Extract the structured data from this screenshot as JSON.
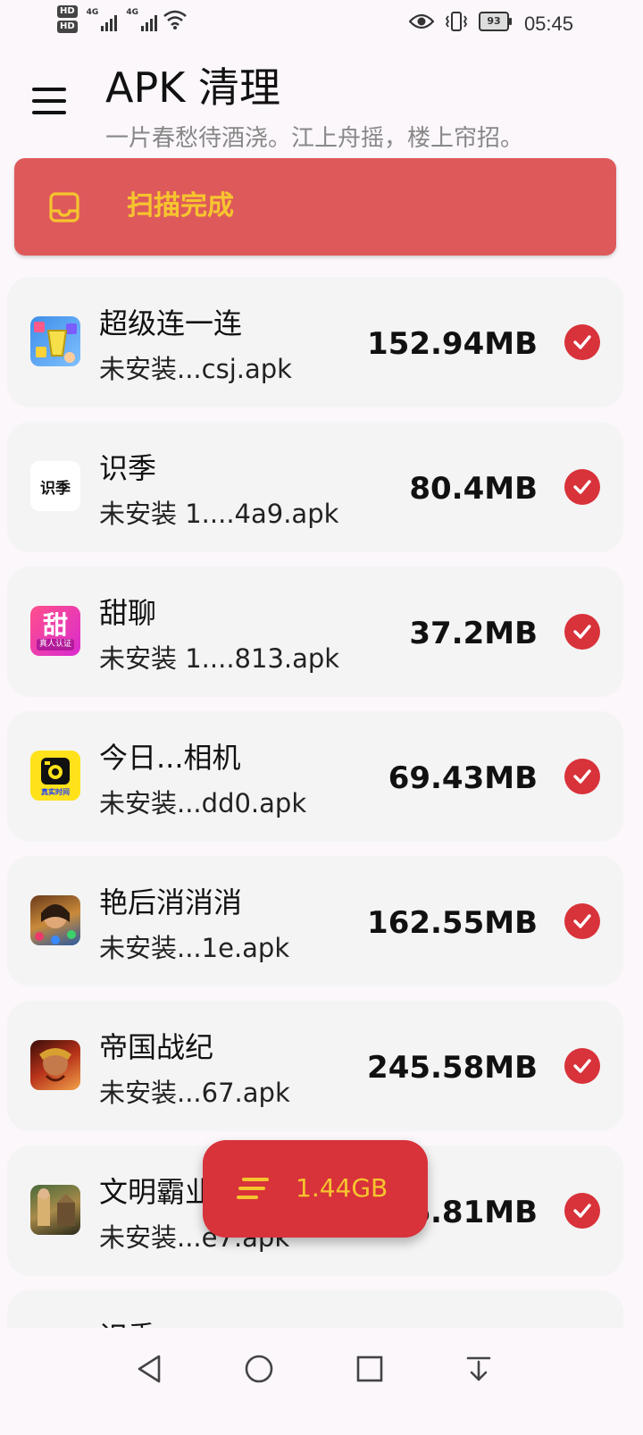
{
  "status_bar": {
    "hd1": "HD",
    "hd2": "HD",
    "net1": "4G",
    "net2": "4G",
    "battery": "93",
    "time": "05:45"
  },
  "header": {
    "title": "APK 清理",
    "subtitle": "一片春愁待酒浇。江上舟摇，楼上帘招。"
  },
  "banner": {
    "status": "扫描完成",
    "icon": "inbox-icon"
  },
  "apps": [
    {
      "name": "超级连一连",
      "file": "未安装...csj.apk",
      "size": "152.94MB"
    },
    {
      "name": "识季",
      "file": "未安装 1....4a9.apk",
      "size": "80.4MB"
    },
    {
      "name": "甜聊",
      "file": "未安装 1....813.apk",
      "size": "37.2MB"
    },
    {
      "name": "今日...相机",
      "file": "未安装...dd0.apk",
      "size": "69.43MB"
    },
    {
      "name": "艳后消消消",
      "file": "未安装...1e.apk",
      "size": "162.55MB"
    },
    {
      "name": "帝国战纪",
      "file": "未安装...67.apk",
      "size": "245.58MB"
    },
    {
      "name": "文明霸业",
      "file": "未安装...e7.apk",
      "size": "66.81MB"
    },
    {
      "name": "识季",
      "file": "",
      "size": ""
    }
  ],
  "icon_text": {
    "shiji": "识季",
    "tian": "甜",
    "tian_sub": "真人认证",
    "jinri_sub": "真实时间"
  },
  "fab": {
    "total": "1.44GB"
  },
  "colors": {
    "accent_red": "#d8323a",
    "banner_red": "#de5a5a",
    "accent_yellow": "#f6c52e"
  }
}
